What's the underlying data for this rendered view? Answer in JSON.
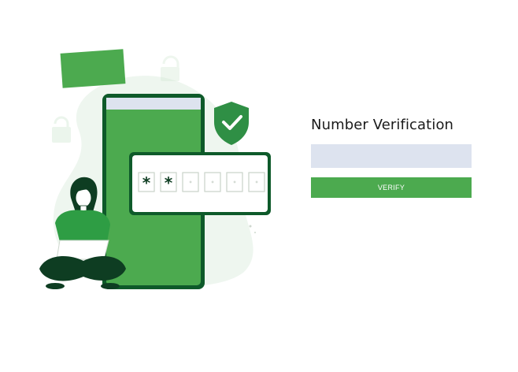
{
  "verification": {
    "title": "Number Verification",
    "code_value": "",
    "code_placeholder": "",
    "verify_label": "VERIFY"
  },
  "illustration": {
    "otp_digits": [
      "*",
      "*",
      "",
      "",
      "",
      ""
    ],
    "colors": {
      "primary_green": "#4caa4f",
      "dark_green": "#0e5a2a",
      "light_green_bg": "#e8f4e9",
      "screen_header": "#dde3ef",
      "input_bg": "#dde3ef"
    },
    "icons": [
      "shield-check-icon",
      "padlock-icon",
      "person-with-laptop"
    ]
  }
}
